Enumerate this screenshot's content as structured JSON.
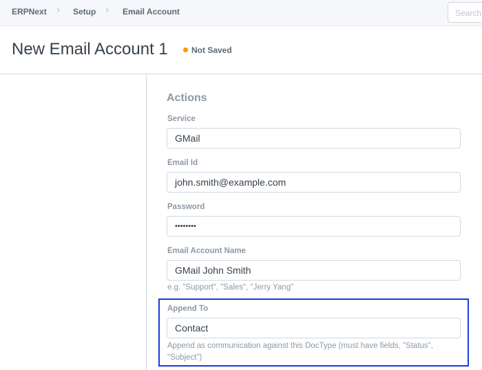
{
  "breadcrumb": [
    "ERPNext",
    "Setup",
    "Email Account"
  ],
  "search": {
    "placeholder": "Search"
  },
  "title": "New Email Account 1",
  "status": "Not Saved",
  "section": "Actions",
  "fields": {
    "service": {
      "label": "Service",
      "value": "GMail"
    },
    "email_id": {
      "label": "Email Id",
      "value": "john.smith@example.com"
    },
    "password": {
      "label": "Password",
      "value": "••••••••"
    },
    "account_name": {
      "label": "Email Account Name",
      "value": "GMail John Smith",
      "help": "e.g. \"Support\", \"Sales\", \"Jerry Yang\""
    },
    "append_to": {
      "label": "Append To",
      "value": "Contact",
      "help": "Append as communication against this DocType (must have fields, \"Status\", \"Subject\")"
    }
  },
  "colors": {
    "status_dot": "#ff9800",
    "highlight": "#1a3ad6"
  }
}
